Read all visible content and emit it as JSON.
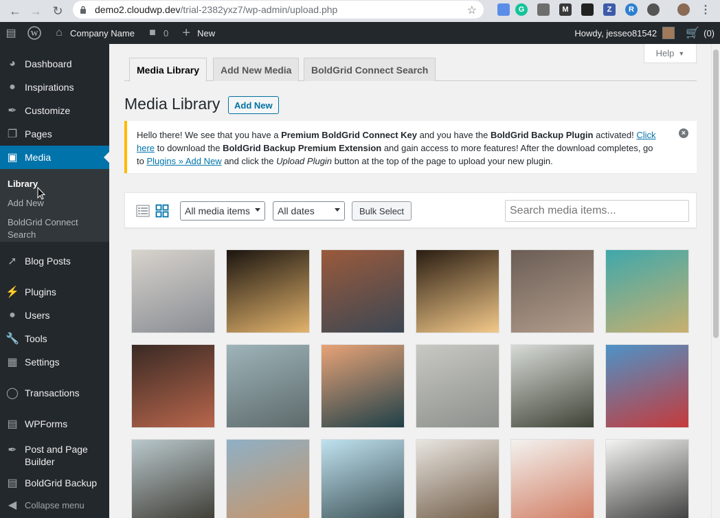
{
  "browser": {
    "url_host": "demo2.cloudwp.dev",
    "url_path": "/trial-2382yxz7/wp-admin/upload.php"
  },
  "adminbar": {
    "site_name": "Company Name",
    "comments_count": "0",
    "new_label": "New",
    "howdy": "Howdy, jesseo81542",
    "cart_count": "(0)"
  },
  "sidebar": {
    "items": [
      {
        "label": "Dashboard",
        "icon": "dashboard-icon"
      },
      {
        "label": "Inspirations",
        "icon": "lightbulb-icon"
      },
      {
        "label": "Customize",
        "icon": "paintbrush-icon"
      },
      {
        "label": "Pages",
        "icon": "pages-icon"
      },
      {
        "label": "Media",
        "icon": "media-icon"
      },
      {
        "label": "Blog Posts",
        "icon": "pin-icon"
      },
      {
        "label": "Plugins",
        "icon": "plugin-icon"
      },
      {
        "label": "Users",
        "icon": "user-icon"
      },
      {
        "label": "Tools",
        "icon": "wrench-icon"
      },
      {
        "label": "Settings",
        "icon": "settings-icon"
      },
      {
        "label": "Transactions",
        "icon": "transactions-icon"
      },
      {
        "label": "WPForms",
        "icon": "wpforms-icon"
      },
      {
        "label": "Post and Page Builder",
        "icon": "builder-icon"
      },
      {
        "label": "BoldGrid Backup",
        "icon": "backup-icon"
      },
      {
        "label": "Collapse menu",
        "icon": "collapse-icon"
      }
    ],
    "submenu": {
      "library": "Library",
      "add_new": "Add New",
      "boldgrid_search": "BoldGrid Connect Search"
    }
  },
  "main": {
    "help_label": "Help",
    "tabs": [
      "Media Library",
      "Add New Media",
      "BoldGrid Connect Search"
    ],
    "title": "Media Library",
    "add_new": "Add New",
    "notice": {
      "t1": "Hello there! We see that you have a ",
      "b1": "Premium BoldGrid Connect Key",
      "t2": " and you have the ",
      "b2": "BoldGrid Backup Plugin",
      "t3": " activated! ",
      "link1": "Click here",
      "t4": " to download the ",
      "b3": "BoldGrid Backup Premium Extension",
      "t5": " and gain access to more features! After the download completes, go to ",
      "link2": "Plugins » Add New",
      "t6": " and click the ",
      "i1": "Upload Plugin",
      "t7": " button at the top of the page to upload your new plugin."
    },
    "filter_type": "All media items",
    "filter_date": "All dates",
    "bulk_select": "Bulk Select",
    "search_placeholder": "Search media items..."
  },
  "thumbnails": [
    {
      "name": "kitten",
      "colors": [
        "#d7d3cc",
        "#8a8d94"
      ]
    },
    {
      "name": "sunset-skateboarders",
      "colors": [
        "#1b1510",
        "#e2b36c"
      ]
    },
    {
      "name": "skateboard-wall",
      "colors": [
        "#9a5a3c",
        "#3c4753"
      ]
    },
    {
      "name": "skate-sunlight",
      "colors": [
        "#2a1d12",
        "#f3c98a"
      ]
    },
    {
      "name": "skate-ruins",
      "colors": [
        "#6b5d55",
        "#b29d8c"
      ]
    },
    {
      "name": "skate-bowl-teal",
      "colors": [
        "#3fa8ab",
        "#c8b06e"
      ]
    },
    {
      "name": "sneakers-board",
      "colors": [
        "#3a2a24",
        "#b8664c"
      ]
    },
    {
      "name": "skatepark-air",
      "colors": [
        "#9eb4b9",
        "#5d6a6b"
      ]
    },
    {
      "name": "skate-bowl-sky",
      "colors": [
        "#e8a377",
        "#1f4049"
      ]
    },
    {
      "name": "concrete-bowl",
      "colors": [
        "#c8c8c3",
        "#8d908c"
      ]
    },
    {
      "name": "road-skater",
      "colors": [
        "#d7dbd7",
        "#3f4336"
      ]
    },
    {
      "name": "graffiti-wall",
      "colors": [
        "#4d93c8",
        "#c63a3b"
      ]
    },
    {
      "name": "skater-crowd",
      "colors": [
        "#b9c8cc",
        "#3d3a32"
      ]
    },
    {
      "name": "beach-skater",
      "colors": [
        "#8fb0c5",
        "#c99466"
      ]
    },
    {
      "name": "jump-sea",
      "colors": [
        "#bfe2ef",
        "#3b4f55"
      ]
    },
    {
      "name": "pocket-watch",
      "colors": [
        "#e8e5e0",
        "#6f5a45"
      ]
    },
    {
      "name": "desk-hand",
      "colors": [
        "#f3f2ef",
        "#d07a60"
      ]
    },
    {
      "name": "laptop-hands",
      "colors": [
        "#f4f4f2",
        "#3c3c3c"
      ]
    }
  ]
}
